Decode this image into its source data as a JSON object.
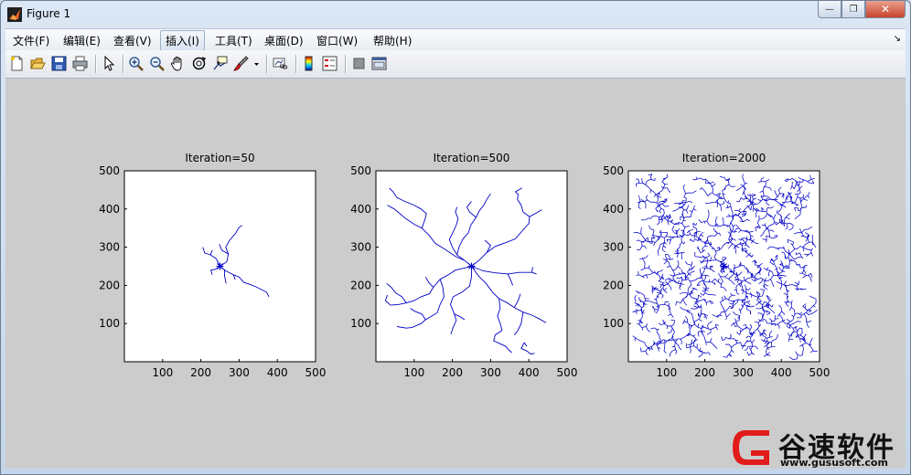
{
  "window": {
    "title": "Figure 1"
  },
  "menu": {
    "items": [
      {
        "label": "文件(F)",
        "name": "menu-file"
      },
      {
        "label": "编辑(E)",
        "name": "menu-edit"
      },
      {
        "label": "查看(V)",
        "name": "menu-view"
      },
      {
        "label": "插入(I)",
        "name": "menu-insert"
      },
      {
        "label": "工具(T)",
        "name": "menu-tools"
      },
      {
        "label": "桌面(D)",
        "name": "menu-desktop"
      },
      {
        "label": "窗口(W)",
        "name": "menu-window"
      },
      {
        "label": "帮助(H)",
        "name": "menu-help"
      }
    ]
  },
  "toolbar": {
    "icons": [
      "new-figure-icon",
      "open-file-icon",
      "save-icon",
      "print-icon",
      "pointer-icon",
      "zoom-in-icon",
      "zoom-out-icon",
      "pan-hand-icon",
      "rotate-3d-icon",
      "data-cursor-icon",
      "brush-icon",
      "brush-dropdown-icon",
      "link-plot-icon",
      "colorbar-icon",
      "legend-icon",
      "hide-plot-tools-icon",
      "show-plot-tools-icon"
    ]
  },
  "colors": {
    "tree": "#0000c8",
    "figure_bg": "#cccccc",
    "axes_bg": "#ffffff"
  },
  "chart_data": [
    {
      "type": "line",
      "title": "Iteration=50",
      "xlim": [
        0,
        500
      ],
      "ylim": [
        0,
        500
      ],
      "xticks": [
        100,
        200,
        300,
        400,
        500
      ],
      "yticks": [
        100,
        200,
        300,
        400,
        500
      ],
      "seed_point": [
        250,
        250
      ],
      "branches": [
        [
          [
            250,
            250
          ],
          [
            240,
            270
          ],
          [
            225,
            280
          ],
          [
            210,
            285
          ],
          [
            205,
            300
          ]
        ],
        [
          [
            250,
            250
          ],
          [
            268,
            262
          ],
          [
            272,
            282
          ],
          [
            265,
            300
          ],
          [
            275,
            318
          ],
          [
            290,
            335
          ],
          [
            300,
            352
          ],
          [
            308,
            357
          ]
        ],
        [
          [
            250,
            250
          ],
          [
            265,
            238
          ],
          [
            285,
            228
          ],
          [
            300,
            222
          ],
          [
            312,
            208
          ],
          [
            330,
            202
          ],
          [
            345,
            196
          ],
          [
            360,
            188
          ],
          [
            372,
            182
          ],
          [
            378,
            170
          ]
        ],
        [
          [
            250,
            250
          ],
          [
            238,
            242
          ],
          [
            226,
            240
          ],
          [
            230,
            228
          ]
        ],
        [
          [
            262,
            240
          ],
          [
            262,
            225
          ],
          [
            266,
            205
          ]
        ],
        [
          [
            272,
            282
          ],
          [
            255,
            292
          ],
          [
            248,
            308
          ]
        ],
        [
          [
            285,
            228
          ],
          [
            290,
            215
          ]
        ],
        [
          [
            225,
            280
          ],
          [
            230,
            292
          ]
        ]
      ]
    },
    {
      "type": "line",
      "title": "Iteration=500",
      "xlim": [
        0,
        500
      ],
      "ylim": [
        0,
        500
      ],
      "xticks": [
        100,
        200,
        300,
        400,
        500
      ],
      "yticks": [
        100,
        200,
        300,
        400,
        500
      ],
      "seed_point": [
        250,
        250
      ],
      "branches": [
        [
          [
            250,
            250
          ],
          [
            232,
            265
          ],
          [
            212,
            280
          ],
          [
            200,
            300
          ],
          [
            192,
            320
          ],
          [
            202,
            340
          ],
          [
            210,
            358
          ],
          [
            215,
            375
          ],
          [
            208,
            392
          ],
          [
            212,
            405
          ]
        ],
        [
          [
            250,
            250
          ],
          [
            270,
            266
          ],
          [
            290,
            286
          ],
          [
            312,
            302
          ],
          [
            340,
            312
          ],
          [
            365,
            322
          ],
          [
            382,
            342
          ],
          [
            400,
            362
          ],
          [
            402,
            380
          ],
          [
            420,
            390
          ],
          [
            434,
            398
          ]
        ],
        [
          [
            402,
            380
          ],
          [
            385,
            392
          ],
          [
            380,
            410
          ],
          [
            370,
            425
          ],
          [
            372,
            438
          ],
          [
            365,
            445
          ],
          [
            382,
            455
          ]
        ],
        [
          [
            250,
            250
          ],
          [
            280,
            238
          ],
          [
            310,
            233
          ],
          [
            345,
            230
          ],
          [
            375,
            234
          ],
          [
            408,
            234
          ],
          [
            420,
            230
          ]
        ],
        [
          [
            250,
            250
          ],
          [
            250,
            222
          ],
          [
            245,
            198
          ],
          [
            225,
            182
          ],
          [
            202,
            170
          ],
          [
            195,
            150
          ],
          [
            205,
            125
          ],
          [
            210,
            108
          ],
          [
            202,
            90
          ],
          [
            196,
            72
          ]
        ],
        [
          [
            250,
            250
          ],
          [
            268,
            225
          ],
          [
            288,
            205
          ],
          [
            305,
            182
          ],
          [
            322,
            165
          ],
          [
            342,
            155
          ],
          [
            362,
            142
          ],
          [
            385,
            130
          ],
          [
            408,
            122
          ],
          [
            428,
            112
          ],
          [
            445,
            102
          ]
        ],
        [
          [
            322,
            165
          ],
          [
            325,
            140
          ],
          [
            318,
            120
          ],
          [
            325,
            100
          ],
          [
            330,
            82
          ]
        ],
        [
          [
            330,
            82
          ],
          [
            312,
            70
          ],
          [
            308,
            55
          ],
          [
            340,
            40
          ],
          [
            350,
            28
          ],
          [
            356,
            24
          ]
        ],
        [
          [
            385,
            130
          ],
          [
            380,
            100
          ],
          [
            370,
            80
          ],
          [
            362,
            70
          ]
        ],
        [
          [
            395,
            40
          ],
          [
            388,
            50
          ],
          [
            380,
            35
          ],
          [
            395,
            28
          ],
          [
            405,
            20
          ],
          [
            415,
            22
          ]
        ],
        [
          [
            250,
            250
          ],
          [
            230,
            245
          ],
          [
            208,
            240
          ],
          [
            190,
            228
          ],
          [
            168,
            216
          ],
          [
            150,
            195
          ],
          [
            140,
            178
          ],
          [
            118,
            170
          ],
          [
            100,
            160
          ],
          [
            80,
            154
          ],
          [
            60,
            150
          ],
          [
            38,
            148
          ]
        ],
        [
          [
            168,
            216
          ],
          [
            175,
            195
          ],
          [
            178,
            170
          ],
          [
            168,
            150
          ],
          [
            160,
            128
          ],
          [
            130,
            110
          ],
          [
            118,
            100
          ],
          [
            95,
            90
          ],
          [
            80,
            88
          ],
          [
            55,
            92
          ]
        ],
        [
          [
            130,
            110
          ],
          [
            120,
            125
          ],
          [
            102,
            132
          ],
          [
            90,
            140
          ]
        ],
        [
          [
            232,
            265
          ],
          [
            208,
            276
          ],
          [
            180,
            295
          ],
          [
            155,
            310
          ],
          [
            140,
            330
          ],
          [
            120,
            350
          ],
          [
            100,
            360
          ],
          [
            78,
            375
          ],
          [
            60,
            390
          ],
          [
            48,
            400
          ],
          [
            30,
            410
          ]
        ],
        [
          [
            120,
            350
          ],
          [
            128,
            372
          ],
          [
            132,
            388
          ],
          [
            118,
            400
          ],
          [
            100,
            410
          ],
          [
            75,
            420
          ],
          [
            55,
            430
          ],
          [
            45,
            445
          ],
          [
            35,
            455
          ]
        ],
        [
          [
            212,
            280
          ],
          [
            218,
            302
          ],
          [
            228,
            322
          ],
          [
            242,
            338
          ],
          [
            248,
            358
          ],
          [
            262,
            378
          ],
          [
            270,
            395
          ],
          [
            282,
            410
          ],
          [
            290,
            425
          ],
          [
            300,
            440
          ]
        ],
        [
          [
            262,
            378
          ],
          [
            245,
            392
          ],
          [
            238,
            405
          ],
          [
            250,
            420
          ]
        ],
        [
          [
            80,
            154
          ],
          [
            68,
            170
          ],
          [
            52,
            180
          ],
          [
            40,
            195
          ],
          [
            28,
            205
          ]
        ],
        [
          [
            38,
            148
          ],
          [
            25,
            160
          ],
          [
            30,
            175
          ]
        ],
        [
          [
            345,
            230
          ],
          [
            352,
            215
          ],
          [
            358,
            200
          ]
        ],
        [
          [
            408,
            234
          ],
          [
            410,
            248
          ]
        ],
        [
          [
            290,
            286
          ],
          [
            300,
            305
          ],
          [
            285,
            318
          ]
        ],
        [
          [
            362,
            142
          ],
          [
            372,
            160
          ],
          [
            378,
            178
          ]
        ],
        [
          [
            205,
            125
          ],
          [
            220,
            118
          ],
          [
            232,
            110
          ]
        ],
        [
          [
            150,
            195
          ],
          [
            138,
            208
          ],
          [
            130,
            222
          ]
        ]
      ]
    },
    {
      "type": "line",
      "title": "Iteration=2000",
      "xlim": [
        0,
        500
      ],
      "ylim": [
        0,
        500
      ],
      "xticks": [
        100,
        200,
        300,
        400,
        500
      ],
      "yticks": [
        100,
        200,
        300,
        400,
        500
      ],
      "seed_point": [
        250,
        250
      ],
      "random_tree": {
        "walkers": 2000,
        "seed": 7,
        "step": 8,
        "radius": 250
      }
    }
  ],
  "watermark": {
    "brand": "谷速软件",
    "url": "www.gususoft.com"
  }
}
